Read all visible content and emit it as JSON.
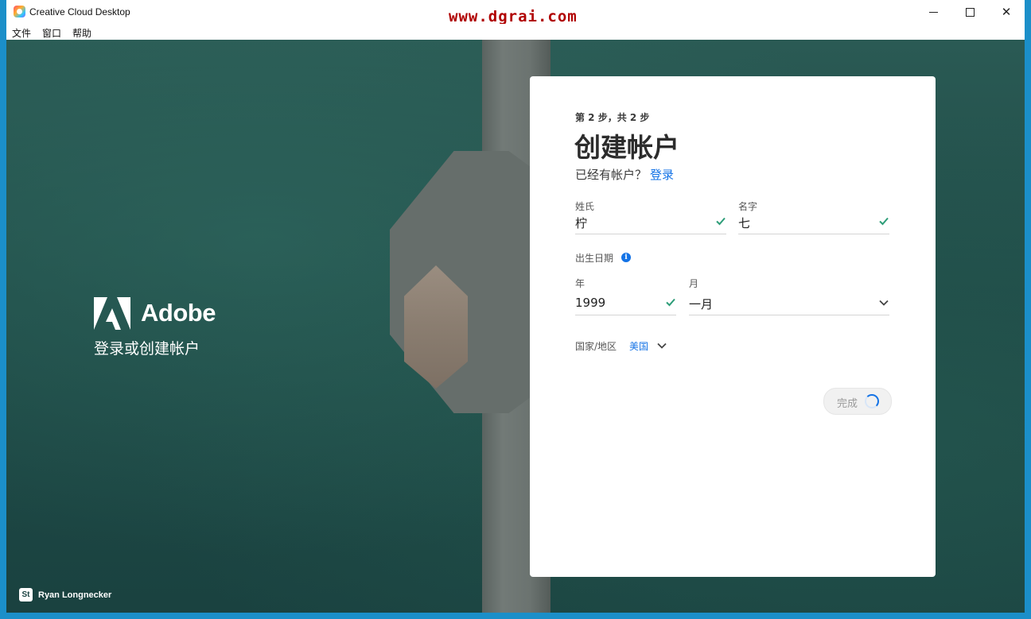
{
  "window": {
    "title": "Creative Cloud Desktop",
    "controls": {
      "minimize": "minimize",
      "maximize": "maximize",
      "close": "✕"
    }
  },
  "watermark": "www.dgrai.com",
  "menu": [
    "文件",
    "窗口",
    "帮助"
  ],
  "brand": {
    "name": "Adobe",
    "tagline": "登录或创建帐户"
  },
  "photo_credit": {
    "badge": "St",
    "name": "Ryan Longnecker"
  },
  "form": {
    "step": "第 2 步，共 2 步",
    "title": "创建帐户",
    "have_account": "已经有帐户？",
    "login_link": "登录",
    "last_name": {
      "label": "姓氏",
      "value": "柠",
      "valid": true
    },
    "first_name": {
      "label": "名字",
      "value": "七",
      "valid": true
    },
    "dob_label": "出生日期",
    "year": {
      "label": "年",
      "value": "1999",
      "valid": true
    },
    "month": {
      "label": "月",
      "value": "一月"
    },
    "country_label": "国家/地区",
    "country_value": "美国",
    "submit_label": "完成"
  },
  "colors": {
    "accent": "#1473e6",
    "valid_check": "#2d9d78",
    "hero_bg": "#1f4b47"
  }
}
